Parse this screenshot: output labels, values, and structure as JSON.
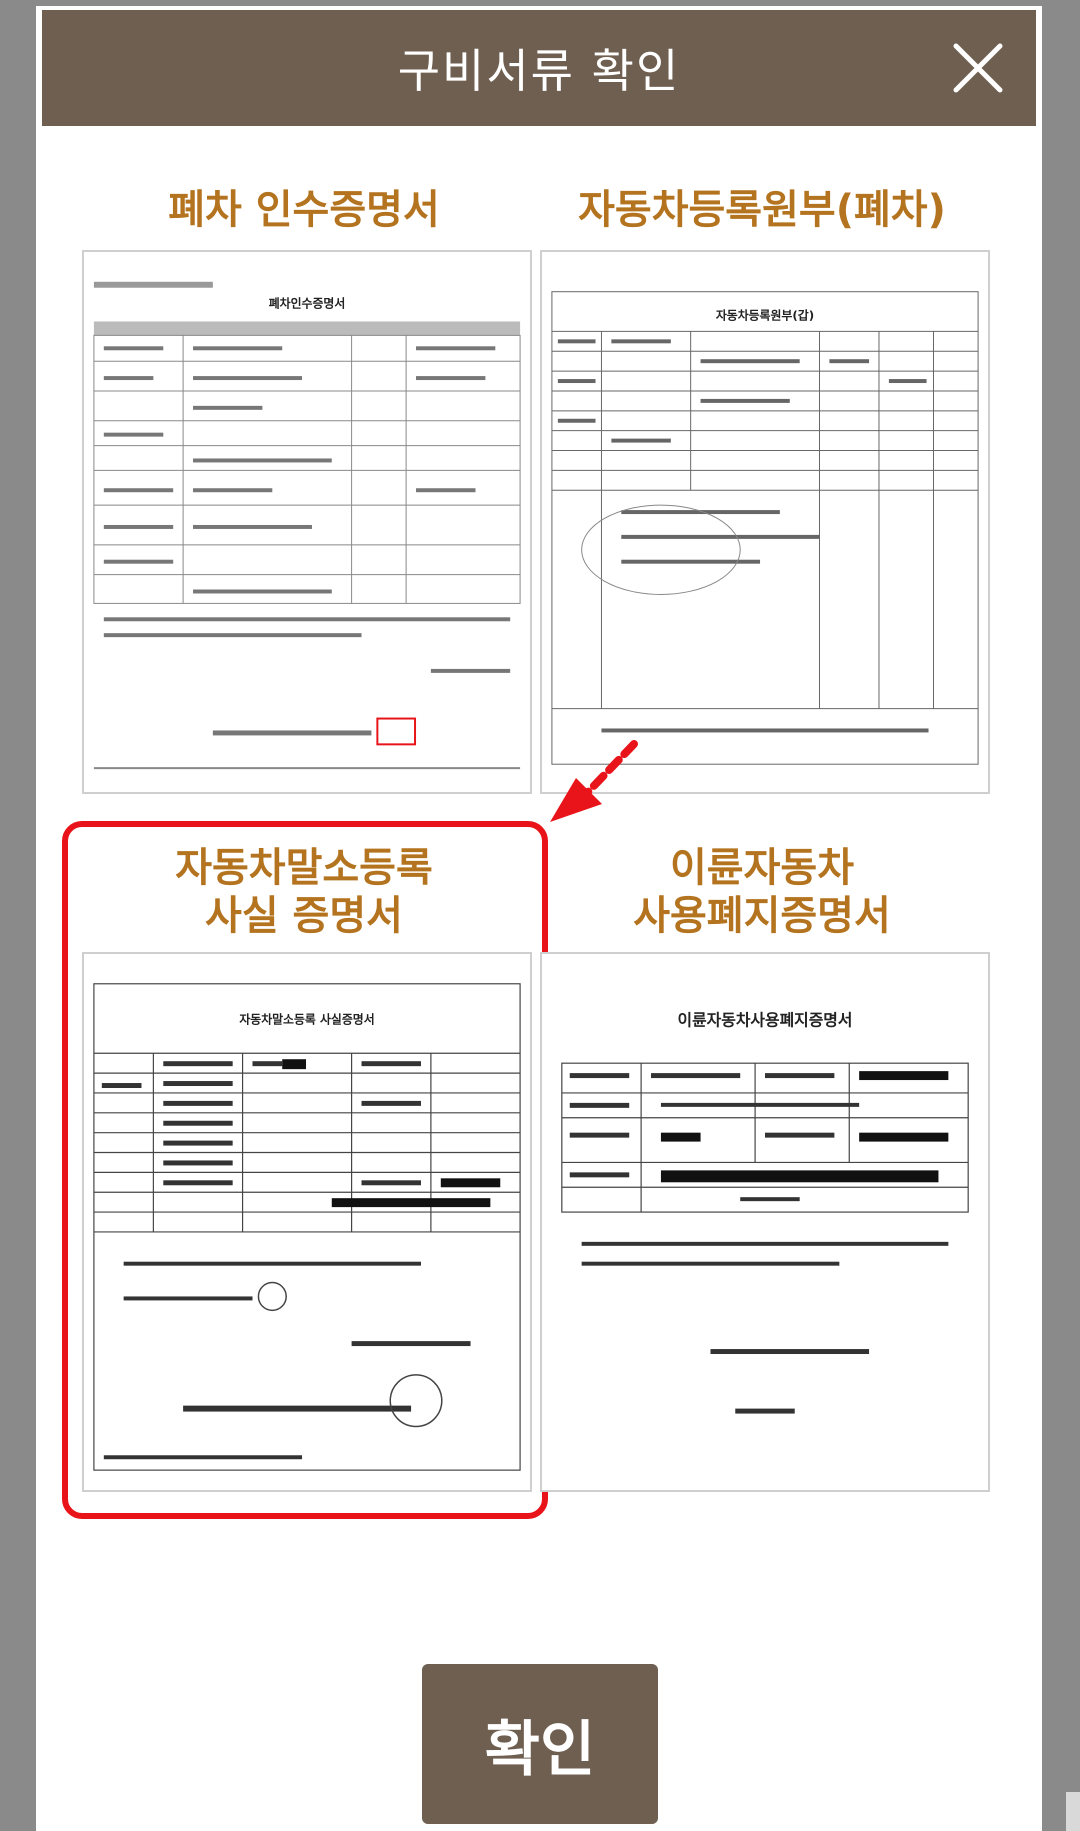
{
  "modal": {
    "title": "구비서류 확인",
    "close_icon": "close-icon"
  },
  "documents": [
    {
      "label": "폐차 인수증명서",
      "thumb_title": "폐차인수증명서"
    },
    {
      "label": "자동차등록원부(폐차)",
      "thumb_title": "자동차등록원부(갑)"
    },
    {
      "label_line1": "자동차말소등록",
      "label_line2": "사실 증명서",
      "thumb_title": "자동차말소등록 사실증명서"
    },
    {
      "label_line1": "이륜자동차",
      "label_line2": "사용폐지증명서",
      "thumb_title": "이륜자동차사용폐지증명서"
    }
  ],
  "highlight_color": "#e8141a",
  "header_color": "#6f5f51",
  "label_color": "#b4731f",
  "confirm_button": {
    "label": "확인"
  }
}
